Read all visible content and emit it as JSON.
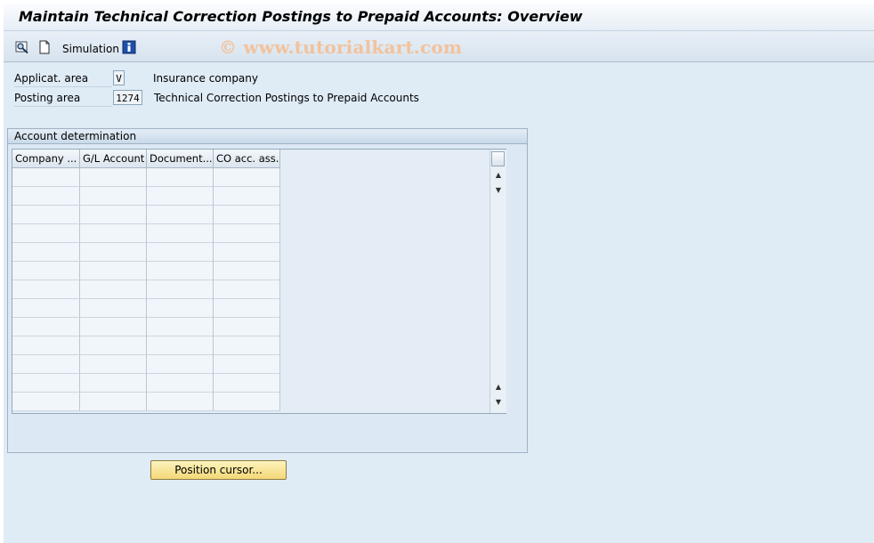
{
  "window": {
    "title": "Maintain Technical Correction Postings to Prepaid Accounts: Overview"
  },
  "toolbar": {
    "items": [
      {
        "icon": "display-change-icon"
      },
      {
        "icon": "new-document-icon"
      },
      {
        "label": "Simulation"
      },
      {
        "icon": "info-icon"
      }
    ],
    "simulation_label": "Simulation",
    "watermark": "© www.tutorialkart.com"
  },
  "header_fields": {
    "applic_area": {
      "label": "Applicat. area",
      "value": "V",
      "description": "Insurance company"
    },
    "posting_area": {
      "label": "Posting area",
      "value": "1274",
      "description": "Technical Correction Postings to Prepaid Accounts"
    }
  },
  "account_determination": {
    "title": "Account determination",
    "columns": [
      "Company ...",
      "G/L Account",
      "Document...",
      "CO acc. ass."
    ],
    "rows": [
      [
        "",
        "",
        "",
        ""
      ],
      [
        "",
        "",
        "",
        ""
      ],
      [
        "",
        "",
        "",
        ""
      ],
      [
        "",
        "",
        "",
        ""
      ],
      [
        "",
        "",
        "",
        ""
      ],
      [
        "",
        "",
        "",
        ""
      ],
      [
        "",
        "",
        "",
        ""
      ],
      [
        "",
        "",
        "",
        ""
      ],
      [
        "",
        "",
        "",
        ""
      ],
      [
        "",
        "",
        "",
        ""
      ],
      [
        "",
        "",
        "",
        ""
      ],
      [
        "",
        "",
        "",
        ""
      ],
      [
        "",
        "",
        "",
        ""
      ]
    ]
  },
  "buttons": {
    "position_cursor": "Position cursor..."
  },
  "colors": {
    "background": "#dfebf5",
    "button_yellow": "#f4d877",
    "watermark": "#f2c29c"
  }
}
